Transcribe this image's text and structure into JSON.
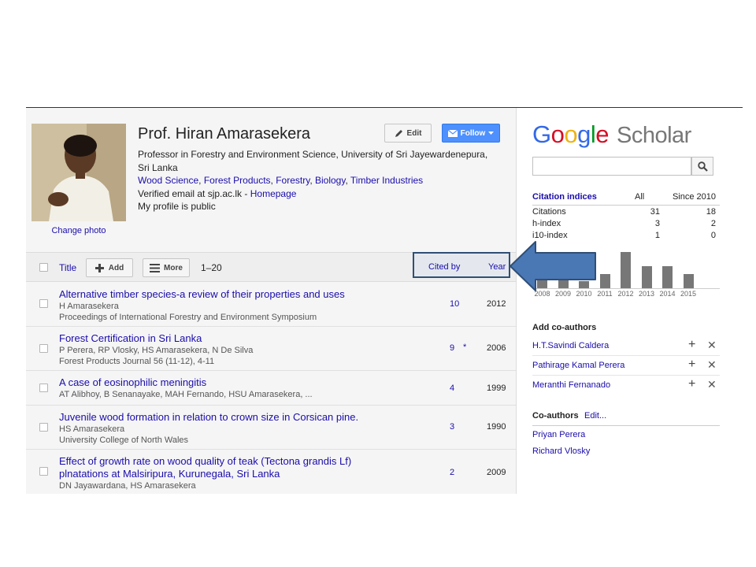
{
  "profile": {
    "name": "Prof. Hiran Amarasekera",
    "affiliation_line1": "Professor in Forestry and Environment Science, University of Sri Jayewardenepura,",
    "affiliation_line2": "Sri Lanka",
    "interests": [
      "Wood Science",
      "Forest Products",
      "Forestry",
      "Biology",
      "Timber Industries"
    ],
    "interests_sep": ", ",
    "email_text": "Verified email at sjp.ac.lk - ",
    "homepage_label": "Homepage",
    "public_text": "My profile is public",
    "change_photo": "Change photo"
  },
  "buttons": {
    "edit": "Edit",
    "follow": "Follow",
    "add": "Add",
    "more": "More"
  },
  "toolbar": {
    "title_label": "Title",
    "range": "1–20",
    "cited_by_label": "Cited by",
    "year_label": "Year"
  },
  "articles": [
    {
      "title": "Alternative timber species-a review of their properties and uses",
      "title2": "",
      "authors": "H Amarasekera",
      "venue": "Proceedings of International Forestry and Environment Symposium",
      "cited_by": "10",
      "star": "",
      "year": "2012"
    },
    {
      "title": "Forest Certification in Sri Lanka",
      "title2": "",
      "authors": "P Perera, RP Vlosky, HS Amarasekera, N De Silva",
      "venue": "Forest Products Journal 56 (11-12), 4-11",
      "cited_by": "9",
      "star": "*",
      "year": "2006"
    },
    {
      "title": "A case of eosinophilic meningitis",
      "title2": "",
      "authors": "AT Alibhoy, B Senanayake, MAH Fernando, HSU Amarasekera, ...",
      "venue": "",
      "cited_by": "4",
      "star": "",
      "year": "1999"
    },
    {
      "title": "Juvenile wood formation in relation to crown size in Corsican pine.",
      "title2": "",
      "authors": "HS Amarasekera",
      "venue": "University College of North Wales",
      "cited_by": "3",
      "star": "",
      "year": "1990"
    },
    {
      "title": "Effect of growth rate on wood quality of teak (Tectona grandis Lf)",
      "title2": "plnatations at Malsiripura, Kurunegala, Sri Lanka",
      "authors": "DN Jayawardana, HS Amarasekera",
      "venue": "",
      "cited_by": "2",
      "star": "",
      "year": "2009"
    }
  ],
  "sidebar": {
    "logo_letters": [
      "G",
      "o",
      "o",
      "g",
      "l",
      "e"
    ],
    "logo_scholar": "Scholar",
    "search_placeholder": "",
    "citation_indices": {
      "title": "Citation indices",
      "col_all": "All",
      "col_since": "Since 2010",
      "rows": [
        {
          "label": "Citations",
          "all": "31",
          "since": "18"
        },
        {
          "label": "h-index",
          "all": "3",
          "since": "2"
        },
        {
          "label": "i10-index",
          "all": "1",
          "since": "0"
        }
      ]
    },
    "add_coauthors_title": "Add co-authors",
    "suggested_coauthors": [
      "H.T.Savindi Caldera",
      "Pathirage Kamal Perera",
      "Meranthi Fernanado"
    ],
    "coauthors_title": "Co-authors",
    "coauthors_edit": "Edit...",
    "coauthors": [
      "Priyan Perera",
      "Richard Vlosky"
    ]
  },
  "chart_data": {
    "type": "bar",
    "title": "",
    "xlabel": "",
    "ylabel": "",
    "categories": [
      "2008",
      "2009",
      "2010",
      "2011",
      "2012",
      "2013",
      "2014",
      "2015"
    ],
    "values": [
      2,
      2,
      1,
      2,
      5,
      3,
      3,
      2
    ],
    "ylim": [
      0,
      5
    ],
    "bar_color": "#777777"
  },
  "colors": {
    "link": "#1a0dab",
    "follow_button": "#4d90fe",
    "callout_arrow": "#4a78b5",
    "callout_border": "#2f4f75"
  },
  "icons": [
    "pencil-icon",
    "envelope-icon",
    "caret-down-icon",
    "plus-icon",
    "menu-icon",
    "search-icon",
    "close-icon",
    "star-icon",
    "arrow-callout-icon"
  ]
}
